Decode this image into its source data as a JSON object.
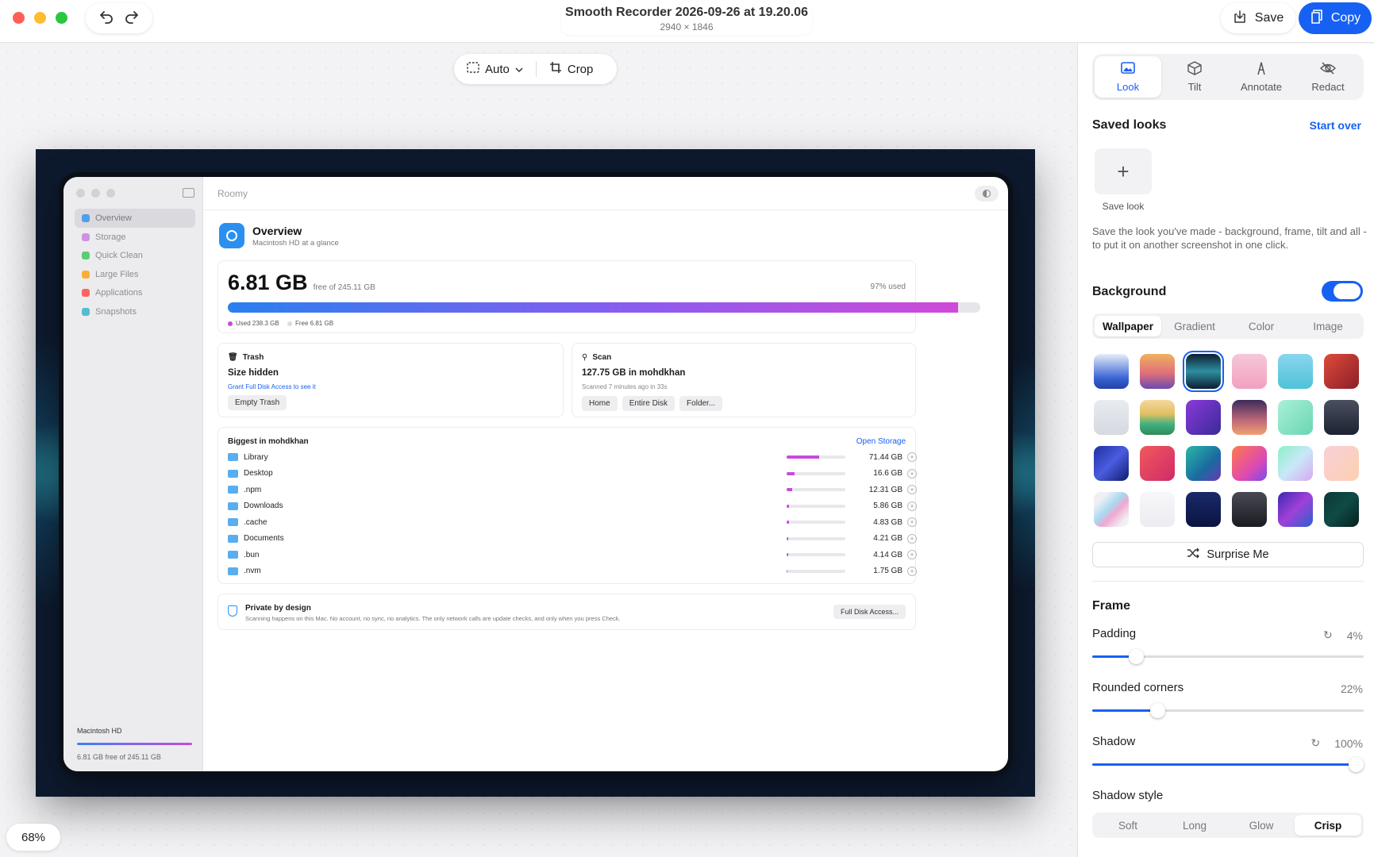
{
  "window": {
    "title": "Smooth Recorder 2026-09-26 at 19.20.06",
    "dimensions": "2940 × 1846",
    "save_label": "Save",
    "copy_label": "Copy",
    "traffic_lights": {
      "close": "#fe5f57",
      "minimize": "#febc2e",
      "zoom": "#28c840"
    }
  },
  "toolbar": {
    "auto_label": "Auto",
    "crop_label": "Crop"
  },
  "zoom": "68%",
  "preview": {
    "app_title": "Roomy",
    "nav": [
      {
        "label": "Overview",
        "color": "#2a90f0"
      },
      {
        "label": "Storage",
        "color": "#c77ce0"
      },
      {
        "label": "Quick Clean",
        "color": "#34c759"
      },
      {
        "label": "Large Files",
        "color": "#ff9f0a"
      },
      {
        "label": "Applications",
        "color": "#ff453a"
      },
      {
        "label": "Snapshots",
        "color": "#30b0c7"
      }
    ],
    "sidebar_storage": {
      "name": "Macintosh HD",
      "detail": "6.81 GB free of 245.11 GB"
    },
    "overview": {
      "title": "Overview",
      "subtitle": "Macintosh HD at a glance"
    },
    "disk": {
      "free": "6.81 GB",
      "free_of": "free of 245.11 GB",
      "used_pct_label": "97% used",
      "used_fraction": 0.97,
      "used_legend": "Used 238.3 GB",
      "free_legend": "Free 6.81 GB"
    },
    "trash": {
      "title": "Trash",
      "size": "Size hidden",
      "link": "Grant Full Disk Access to see it",
      "button": "Empty Trash"
    },
    "scan": {
      "title": "Scan",
      "summary": "127.75 GB in mohdkhan",
      "detail": "Scanned 7 minutes ago in 33s",
      "buttons": [
        "Home",
        "Entire Disk",
        "Folder..."
      ]
    },
    "biggest": {
      "title": "Biggest in mohdkhan",
      "link": "Open Storage",
      "rows": [
        {
          "name": "Library",
          "size": "71.44 GB",
          "fraction": 0.55
        },
        {
          "name": "Desktop",
          "size": "16.6 GB",
          "fraction": 0.13
        },
        {
          "name": ".npm",
          "size": "12.31 GB",
          "fraction": 0.09
        },
        {
          "name": "Downloads",
          "size": "5.86 GB",
          "fraction": 0.045
        },
        {
          "name": ".cache",
          "size": "4.83 GB",
          "fraction": 0.037
        },
        {
          "name": "Documents",
          "size": "4.21 GB",
          "fraction": 0.032
        },
        {
          "name": ".bun",
          "size": "4.14 GB",
          "fraction": 0.031
        },
        {
          "name": ".nvm",
          "size": "1.75 GB",
          "fraction": 0.014
        }
      ]
    },
    "privacy": {
      "title": "Private by design",
      "text": "Scanning happens on this Mac. No account, no sync, no analytics. The only network calls are update checks, and only when you press Check.",
      "button": "Full Disk Access..."
    }
  },
  "panel": {
    "tabs": [
      {
        "label": "Look",
        "icon": "image-icon"
      },
      {
        "label": "Tilt",
        "icon": "cube-icon"
      },
      {
        "label": "Annotate",
        "icon": "pen-icon"
      },
      {
        "label": "Redact",
        "icon": "eye-slash-icon"
      }
    ],
    "saved_looks": {
      "title": "Saved looks",
      "start_over": "Start over",
      "save_look": "Save look",
      "description": "Save the look you've made - background, frame, tilt and all - to put it on another screenshot in one click."
    },
    "background": {
      "title": "Background",
      "enabled": true,
      "tabs": [
        "Wallpaper",
        "Gradient",
        "Color",
        "Image"
      ],
      "selected_tab": "Wallpaper",
      "selected_index": 2,
      "swatches": [
        "linear-gradient(180deg,#e6eef9,#3a63d4 70%,#2142a8)",
        "linear-gradient(180deg,#f0b060,#e0707a 55%,#6a4ab0)",
        "linear-gradient(180deg,#0d1d33,#2e8fa0 50%,#0d1d33)",
        "linear-gradient(180deg,#f6c7d8,#f2a0c0)",
        "linear-gradient(180deg,#8ad6ee,#4ec2d8)",
        "linear-gradient(135deg,#e04a3a,#8a1f2a)",
        "linear-gradient(180deg,#e8ebef,#d5d9e0)",
        "linear-gradient(180deg,#f4d8a0,#e0c060 40%,#40b080 70%,#2e8a5a)",
        "linear-gradient(135deg,#8a3ad8,#3a2a9a)",
        "linear-gradient(180deg,#3b2b5a,#c26a7a 60%,#f0a070)",
        "linear-gradient(135deg,#aaf0d8,#6ad6b0)",
        "linear-gradient(180deg,#4a5060,#1c2230)",
        "linear-gradient(135deg,#2030a0,#4a5ce0 50%,#101a6a)",
        "linear-gradient(135deg,#f05a5a,#d02a6a)",
        "linear-gradient(135deg,#2ab8a8,#1a6aa0 60%,#6a3ab0)",
        "linear-gradient(135deg,#ff7a4a,#e04ab0 60%,#7a4af0)",
        "linear-gradient(135deg,#8af0c8,#c8e8f8 50%,#d8a8f0)",
        "linear-gradient(135deg,#f8d0d8,#fcd0b0)",
        "linear-gradient(135deg,#f0f0f4 20%,#a8d8f0 45%,#f0a8d0 60%,#f0f0f4 85%)",
        "linear-gradient(180deg,#f7f7fa,#ececf1)",
        "linear-gradient(180deg,#1a2a6a,#0a1440)",
        "linear-gradient(180deg,#4a4a55,#1a1a20)",
        "linear-gradient(135deg,#3a2ab0,#a040d8 50%,#2a60d0)",
        "linear-gradient(135deg,#0a3a3a,#104a44 50%,#06201e)"
      ],
      "surprise": "Surprise Me"
    },
    "frame": {
      "title": "Frame",
      "padding": {
        "label": "Padding",
        "value": "4%",
        "fraction": 0.16
      },
      "rounded": {
        "label": "Rounded corners",
        "value": "22%",
        "fraction": 0.24
      },
      "shadow": {
        "label": "Shadow",
        "value": "100%",
        "fraction": 1.0
      },
      "shadow_style": {
        "label": "Shadow style",
        "options": [
          "Soft",
          "Long",
          "Glow",
          "Crisp"
        ],
        "selected": "Crisp"
      }
    }
  },
  "colors": {
    "accent": "#1661f4"
  }
}
